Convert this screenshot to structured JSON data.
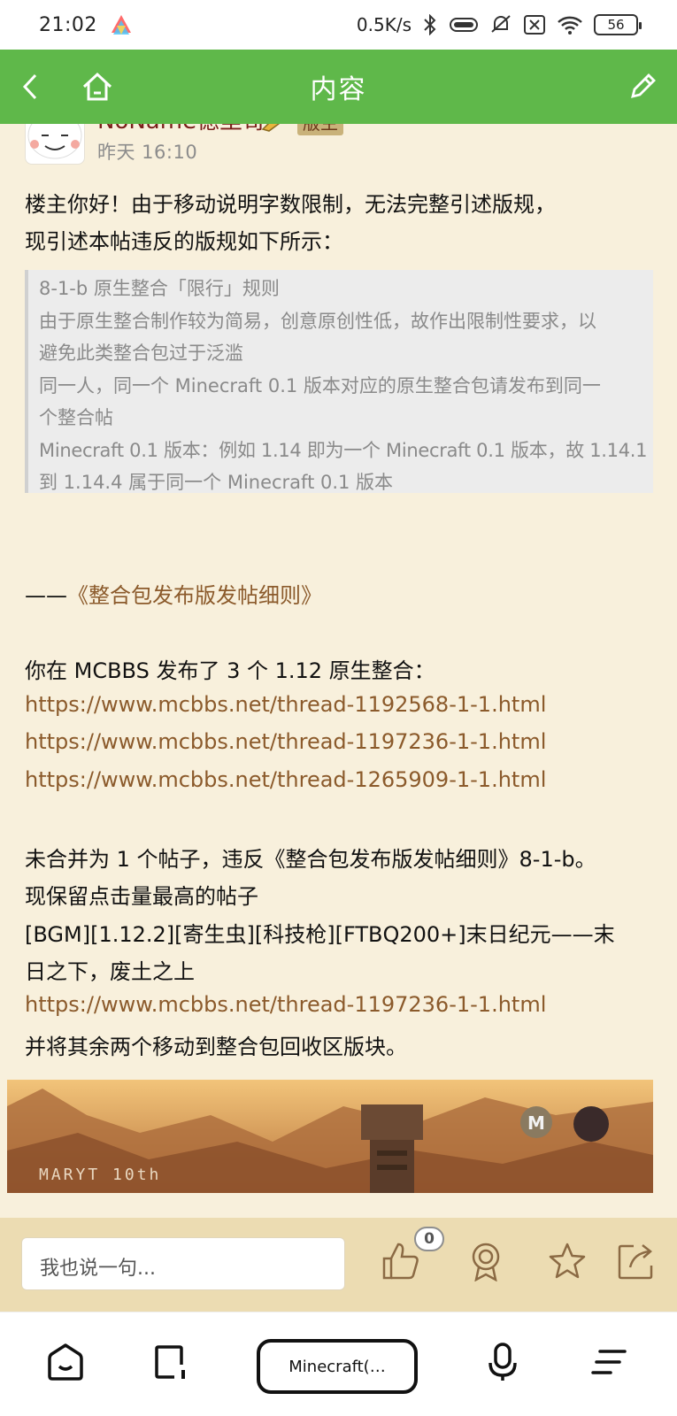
{
  "status_bar": {
    "time": "21:02",
    "network_speed": "0.5K/s",
    "battery": "56",
    "icons": [
      "app-logo-icon",
      "bluetooth-icon",
      "vibrate-icon",
      "mute-icon",
      "sim-x-icon",
      "wifi-icon",
      "battery-icon"
    ]
  },
  "header": {
    "title": "内容",
    "back_icon": "back-arrow-icon",
    "home_icon": "home-icon",
    "edit_icon": "edit-pencil-icon",
    "background": "#5fb84a"
  },
  "post": {
    "author": "NoName德里哥",
    "role_badge": "版主",
    "time": "昨天 16:10",
    "intro_line1": "楼主你好！由于移动说明字数限制，无法完整引述版规，",
    "intro_line2": "现引述本帖违反的版规如下所示：",
    "quote": [
      "8-1-b 原生整合「限行」规则",
      "由于原生整合制作较为简易，创意原创性低，故作出限制性要求，以",
      "避免此类整合包过于泛滥",
      "同一人，同一个 Minecraft 0.1 版本对应的原生整合包请发布到同一",
      "个整合帖",
      "Minecraft 0.1 版本：例如 1.14 即为一个 Minecraft 0.1 版本，故 1.14.1",
      "到 1.14.4 属于同一个 Minecraft 0.1 版本"
    ],
    "source_dash": "——",
    "source_title": "《整合包发布版发帖细则》",
    "published_line": "你在 MCBBS 发布了 3 个 1.12 原生整合：",
    "links": [
      "https://www.mcbbs.net/thread-1192568-1-1.html",
      "https://www.mcbbs.net/thread-1197236-1-1.html",
      "https://www.mcbbs.net/thread-1265909-1-1.html"
    ],
    "violation_line": "未合并为 1 个帖子，违反《整合包发布版发帖细则》8-1-b。",
    "keep_line": "现保留点击量最高的帖子",
    "kept_title_line1": "[BGM][1.12.2][寄生虫][科技枪][FTBQ200+]末日纪元——末",
    "kept_title_line2": "日之下，废土之上",
    "kept_link": "https://www.mcbbs.net/thread-1197236-1-1.html",
    "final_line": "并将其余两个移动到整合包回收区版块。",
    "banner_caption": "MARYT 10th"
  },
  "comment_bar": {
    "placeholder": "我也说一句...",
    "like_count": "0",
    "icons": [
      "thumbs-up-icon",
      "award-icon",
      "star-icon",
      "share-icon"
    ]
  },
  "nav_bar": {
    "url_label": "Minecraft(…",
    "icons": [
      "home-icon",
      "tabs-icon",
      "microphone-icon",
      "menu-icon"
    ]
  }
}
